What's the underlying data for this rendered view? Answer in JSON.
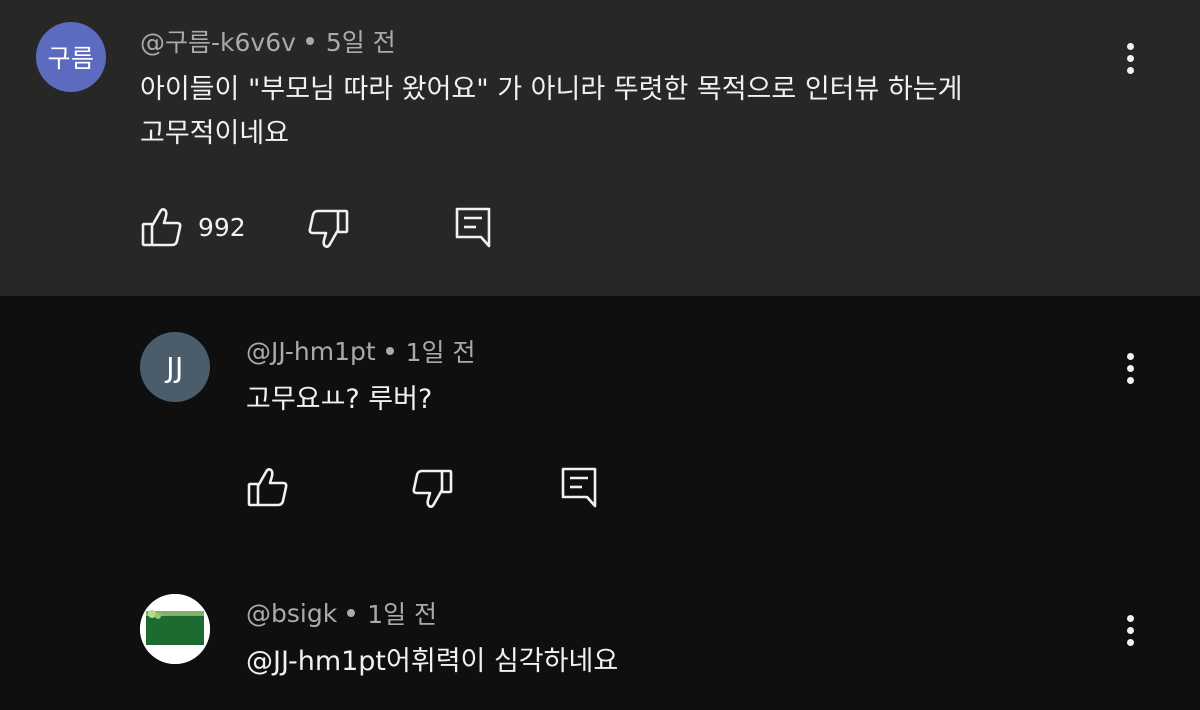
{
  "comments": [
    {
      "avatar_text": "구름",
      "avatar_color": "#5c6bc0",
      "handle": "@구름-k6v6v",
      "time": "5일 전",
      "text": "아이들이 \"부모님 따라 왔어요\" 가 아니라 뚜렷한 목적으로 인터뷰 하는게\n고무적이네요",
      "likes": "992",
      "icons": {
        "like": "thumbs-up-icon",
        "dislike": "thumbs-down-icon",
        "reply": "reply-icon",
        "more": "more-vert-icon"
      }
    },
    {
      "avatar_text": "JJ",
      "avatar_color": "#4b5d6b",
      "handle": "@JJ-hm1pt",
      "time": "1일 전",
      "text": "고무요ㅛ?  루버?",
      "likes": ""
    },
    {
      "avatar_text": "",
      "avatar_color": "#ffffff",
      "handle": "@bsigk",
      "time": "1일 전",
      "text": "@JJ-hm1pt어휘력이 심각하네요",
      "likes": ""
    }
  ]
}
